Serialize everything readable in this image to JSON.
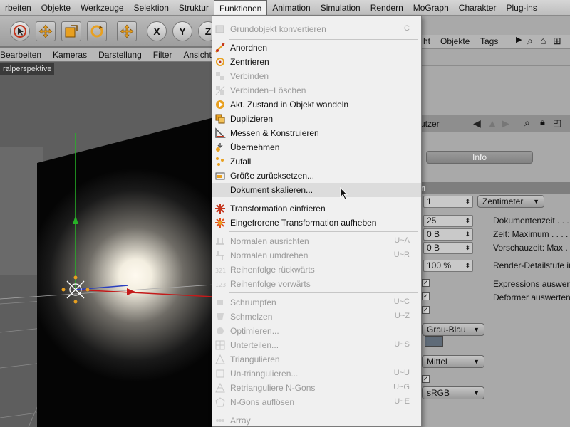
{
  "menubar": {
    "items": [
      "rbeiten",
      "Objekte",
      "Werkzeuge",
      "Selektion",
      "Struktur",
      "Funktionen",
      "Animation",
      "Simulation",
      "Rendern",
      "MoGraph",
      "Charakter",
      "Plug-ins"
    ],
    "active_index": 5
  },
  "toolbar": {
    "buttons": [
      "live-selection",
      "move",
      "scale",
      "rotate",
      "add-move",
      "x-axis",
      "y-axis",
      "z-axis"
    ],
    "letters": [
      "X",
      "Y",
      "Z"
    ]
  },
  "viewport_menu": {
    "items": [
      "Bearbeiten",
      "Kameras",
      "Darstellung",
      "Filter",
      "Ansicht"
    ]
  },
  "viewport": {
    "label": "ralperspektive"
  },
  "object_manager": {
    "menu": [
      "ht",
      "Objekte",
      "Tags"
    ]
  },
  "attribute_manager": {
    "header": "utzer",
    "info_button": "Info",
    "section_label": "n",
    "fields": {
      "scale_value": "1",
      "unit": "Zentimeter",
      "fps": "25",
      "doc_time": "0 B",
      "max_time": "0 B",
      "lod": "100 %",
      "color_scheme": "Grau-Blau",
      "quality": "Mittel",
      "color_profile": "sRGB"
    },
    "labels": {
      "doc_time": "Dokumentenzeit . . .",
      "max_time": "Zeit: Maximum . . . .",
      "preview_time": "Vorschauzeit: Max . .",
      "render_lod": "Render-Detailstufe in",
      "expressions": "Expressions auswert",
      "deformers": "Deformer auswerten"
    }
  },
  "dropdown": {
    "items": [
      {
        "label": "Grundobjekt konvertieren",
        "shortcut": "C",
        "disabled": true
      },
      {
        "label": "Anordnen",
        "shortcut": "",
        "disabled": false
      },
      {
        "label": "Zentrieren",
        "shortcut": "",
        "disabled": false
      },
      {
        "label": "Verbinden",
        "shortcut": "",
        "disabled": true
      },
      {
        "label": "Verbinden+Löschen",
        "shortcut": "",
        "disabled": true
      },
      {
        "label": "Akt. Zustand in Objekt wandeln",
        "shortcut": "",
        "disabled": false
      },
      {
        "label": "Duplizieren",
        "shortcut": "",
        "disabled": false
      },
      {
        "label": "Messen & Konstruieren",
        "shortcut": "",
        "disabled": false
      },
      {
        "label": "Übernehmen",
        "shortcut": "",
        "disabled": false
      },
      {
        "label": "Zufall",
        "shortcut": "",
        "disabled": false
      },
      {
        "label": "Größe zurücksetzen...",
        "shortcut": "",
        "disabled": false
      },
      {
        "label": "Dokument skalieren...",
        "shortcut": "",
        "disabled": false,
        "highlighted": true
      },
      {
        "label": "Transformation einfrieren",
        "shortcut": "",
        "disabled": false
      },
      {
        "label": "Eingefrorene Transformation aufheben",
        "shortcut": "",
        "disabled": false
      },
      {
        "label": "Normalen ausrichten",
        "shortcut": "U~A",
        "disabled": true
      },
      {
        "label": "Normalen umdrehen",
        "shortcut": "U~R",
        "disabled": true
      },
      {
        "label": "Reihenfolge rückwärts",
        "shortcut": "",
        "disabled": true
      },
      {
        "label": "Reihenfolge vorwärts",
        "shortcut": "",
        "disabled": true
      },
      {
        "label": "Schrumpfen",
        "shortcut": "U~C",
        "disabled": true
      },
      {
        "label": "Schmelzen",
        "shortcut": "U~Z",
        "disabled": true
      },
      {
        "label": "Optimieren...",
        "shortcut": "",
        "disabled": true
      },
      {
        "label": "Unterteilen...",
        "shortcut": "U~S",
        "disabled": true
      },
      {
        "label": "Triangulieren",
        "shortcut": "",
        "disabled": true
      },
      {
        "label": "Un-triangulieren...",
        "shortcut": "U~U",
        "disabled": true
      },
      {
        "label": "Retrianguliere N-Gons",
        "shortcut": "U~G",
        "disabled": true
      },
      {
        "label": "N-Gons auflösen",
        "shortcut": "U~E",
        "disabled": true
      },
      {
        "label": "Array",
        "shortcut": "",
        "disabled": true
      }
    ]
  },
  "colors": {
    "accent_red": "#c4341c",
    "accent_orange": "#e8a020",
    "menu_bg": "#f0f0f0",
    "highlight": "#dcdcdc"
  }
}
